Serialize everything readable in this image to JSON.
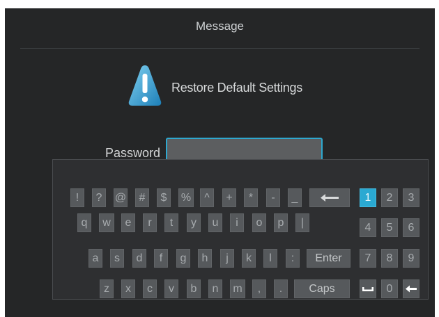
{
  "dialog": {
    "title": "Message",
    "icon": "warning-icon",
    "message": "Restore Default Settings",
    "password_label": "Password",
    "password_value": ""
  },
  "keyboard": {
    "row1": [
      "!",
      "?",
      "@",
      "#",
      "$",
      "%",
      "^",
      "+",
      "*",
      "-",
      "_"
    ],
    "row2": [
      "q",
      "w",
      "e",
      "r",
      "t",
      "y",
      "u",
      "i",
      "o",
      "p",
      "|"
    ],
    "row3": [
      "a",
      "s",
      "d",
      "f",
      "g",
      "h",
      "j",
      "k",
      "l",
      ":"
    ],
    "row4": [
      "z",
      "x",
      "c",
      "v",
      "b",
      "n",
      "m",
      ",",
      "."
    ],
    "enter_label": "Enter",
    "caps_label": "Caps",
    "backspace_icon": "backspace-arrow-icon",
    "numpad": [
      "1",
      "2",
      "3",
      "4",
      "5",
      "6",
      "7",
      "8",
      "9"
    ],
    "numpad_zero": "0",
    "numpad_space_icon": "space-icon",
    "numpad_back_icon": "backspace-arrow-icon",
    "active_key": "1"
  },
  "colors": {
    "accent": "#2aa9d2",
    "dialog_bg": "#252627",
    "key_bg": "#56595c"
  }
}
